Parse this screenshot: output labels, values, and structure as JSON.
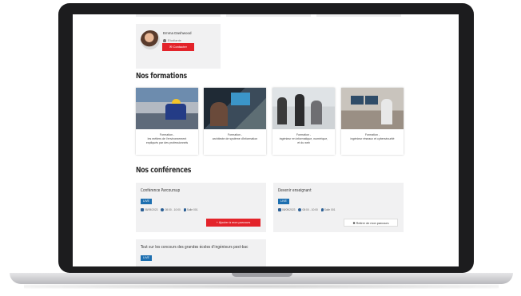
{
  "profile": {
    "name": "Emma Dashwood",
    "role": "Etudiante",
    "contact_label": "Contacter"
  },
  "formations": {
    "title": "Nos formations",
    "items": [
      {
        "label_line1": "Formation -",
        "label_line2": "les métiers de l'environnement",
        "label_line3": "expliqués par des professionnels"
      },
      {
        "label_line1": "Formation -",
        "label_line2": "architecte de système d'information",
        "label_line3": ""
      },
      {
        "label_line1": "Formation -",
        "label_line2": "ingénieur en informatique, numérique,",
        "label_line3": "et du web"
      },
      {
        "label_line1": "Formation -",
        "label_line2": "ingénieur réseaux et cybersécurité",
        "label_line3": ""
      }
    ]
  },
  "conferences": {
    "title": "Nos conférences",
    "items": [
      {
        "title": "Conférence Parcoursup",
        "badge": "LIVE",
        "date": "08/09/2023",
        "time": "08:00 - 10:00",
        "place": "Salle 001",
        "action_label": "Ajouter à mon parcours"
      },
      {
        "title": "Devenir enseignant",
        "badge": "LIVE",
        "date": "08/09/2023",
        "time": "08:00 - 10:00",
        "place": "Salle 001",
        "action_label": "Retirer de mon parcours"
      },
      {
        "title": "Tout sur les concours des grandes écoles d'ingénieurs post-bac",
        "badge": "LIVE"
      }
    ]
  },
  "colors": {
    "accent_red": "#e3232a",
    "live_blue": "#1d6fb0"
  }
}
